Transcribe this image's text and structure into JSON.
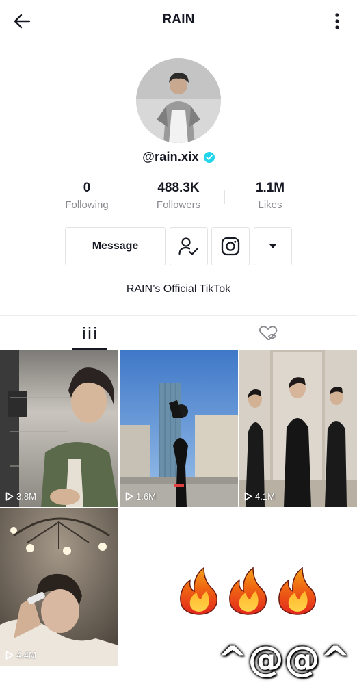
{
  "header": {
    "title": "RAIN",
    "back_icon": "arrow-left-icon",
    "more_icon": "vertical-ellipsis-icon"
  },
  "profile": {
    "handle": "@rain.xix",
    "verified": true,
    "verified_color": "#20d5ec",
    "bio": "RAIN’s Official TikTok"
  },
  "stats": [
    {
      "value": "0",
      "label": "Following"
    },
    {
      "value": "488.3K",
      "label": "Followers"
    },
    {
      "value": "1.1M",
      "label": "Likes"
    }
  ],
  "actions": {
    "message_label": "Message",
    "follow_icon": "person-check-icon",
    "instagram_icon": "instagram-icon",
    "dropdown_icon": "triangle-down-icon"
  },
  "tabs": [
    {
      "name": "videos",
      "icon": "grid-bars-icon",
      "active": true
    },
    {
      "name": "liked",
      "icon": "heart-hidden-icon",
      "active": false
    }
  ],
  "videos": [
    {
      "views": "3.8M"
    },
    {
      "views": "1.6M"
    },
    {
      "views": "4.1M"
    },
    {
      "views": "4.4M"
    }
  ],
  "overlay": {
    "sticker_icon": "fire-emoji-icon",
    "emote_text": "^@@^"
  }
}
